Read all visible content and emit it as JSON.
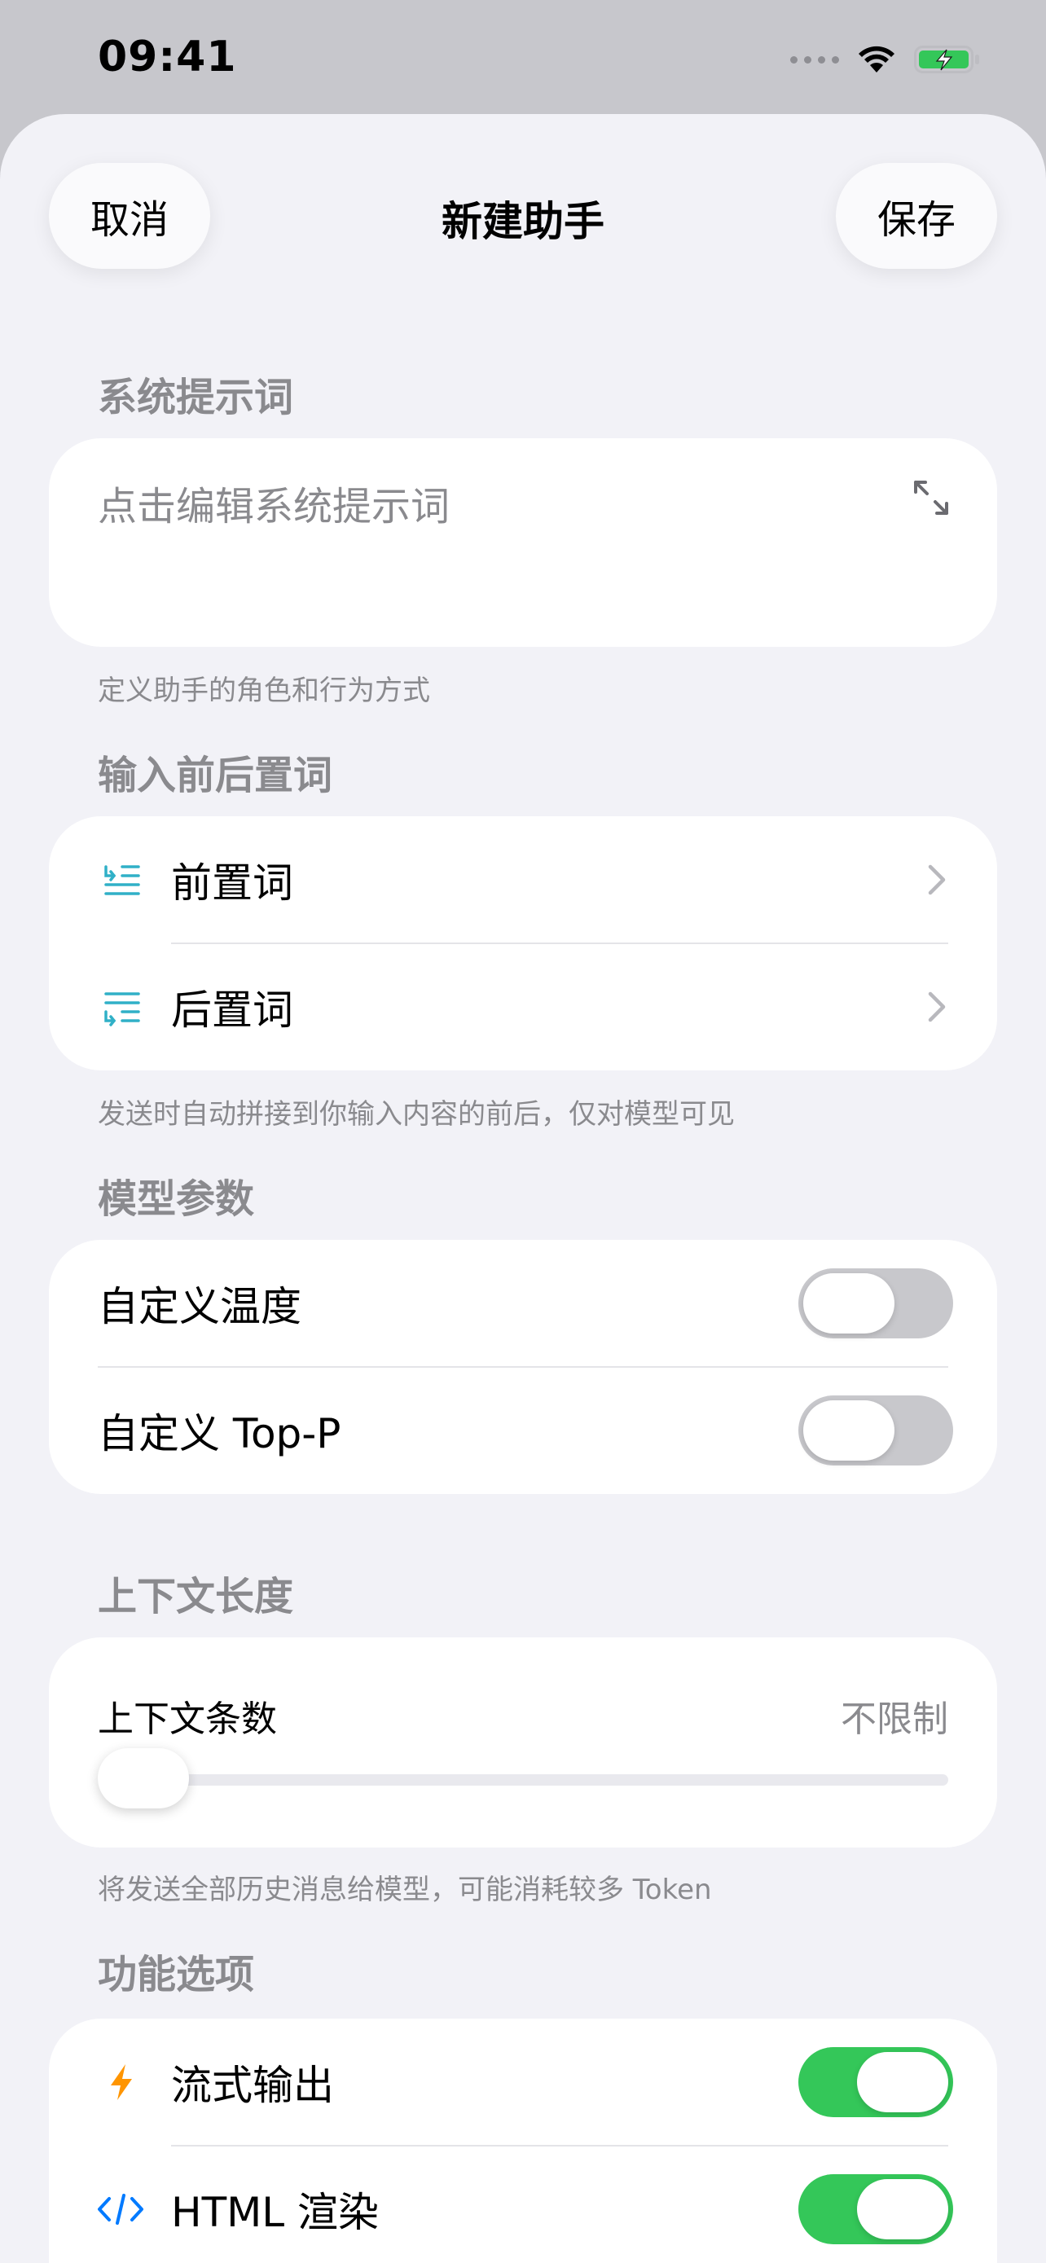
{
  "status_bar": {
    "time": "09:41"
  },
  "nav": {
    "cancel_label": "取消",
    "title": "新建助手",
    "save_label": "保存"
  },
  "system_prompt": {
    "section_title": "系统提示词",
    "placeholder": "点击编辑系统提示词",
    "footnote": "定义助手的角色和行为方式"
  },
  "affixes": {
    "section_title": "输入前后置词",
    "items": [
      {
        "label": "前置词",
        "icon": "prefix-lines-icon"
      },
      {
        "label": "后置词",
        "icon": "suffix-lines-icon"
      }
    ],
    "footnote": "发送时自动拼接到你输入内容的前后，仅对模型可见"
  },
  "model_params": {
    "section_title": "模型参数",
    "items": [
      {
        "label": "自定义温度",
        "enabled": false
      },
      {
        "label": "自定义 Top-P",
        "enabled": false
      }
    ]
  },
  "context": {
    "section_title": "上下文长度",
    "label": "上下文条数",
    "value_label": "不限制",
    "slider_fraction": 0,
    "footnote": "将发送全部历史消息给模型，可能消耗较多 Token"
  },
  "features": {
    "section_title": "功能选项",
    "items": [
      {
        "label": "流式输出",
        "icon": "bolt-icon",
        "icon_color": "#ff9500",
        "enabled": true
      },
      {
        "label": "HTML 渲染",
        "icon": "code-icon",
        "icon_color": "#007aff",
        "enabled": true
      }
    ]
  },
  "colors": {
    "accent_toggle_on": "#34c759",
    "affix_icon": "#30b0c7"
  }
}
